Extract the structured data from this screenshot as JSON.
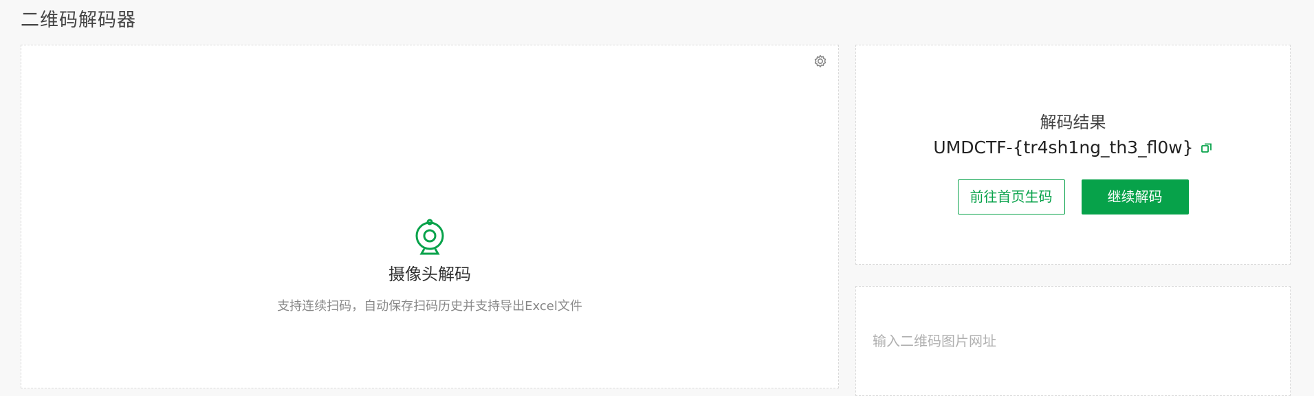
{
  "page": {
    "title": "二维码解码器"
  },
  "camera": {
    "title": "摄像头解码",
    "description": "支持连续扫码，自动保存扫码历史并支持导出Excel文件",
    "settings_icon": "gear-icon",
    "camera_icon": "webcam-icon"
  },
  "result": {
    "label": "解码结果",
    "value": "UMDCTF-{tr4sh1ng_th3_fl0w}",
    "copy_icon": "copy-icon",
    "goto_home_label": "前往首页生码",
    "continue_label": "继续解码"
  },
  "url_input": {
    "placeholder": "输入二维码图片网址",
    "value": ""
  },
  "colors": {
    "accent": "#07a24a",
    "background": "#f8f8f8",
    "panel_border": "#d9d9d9"
  }
}
